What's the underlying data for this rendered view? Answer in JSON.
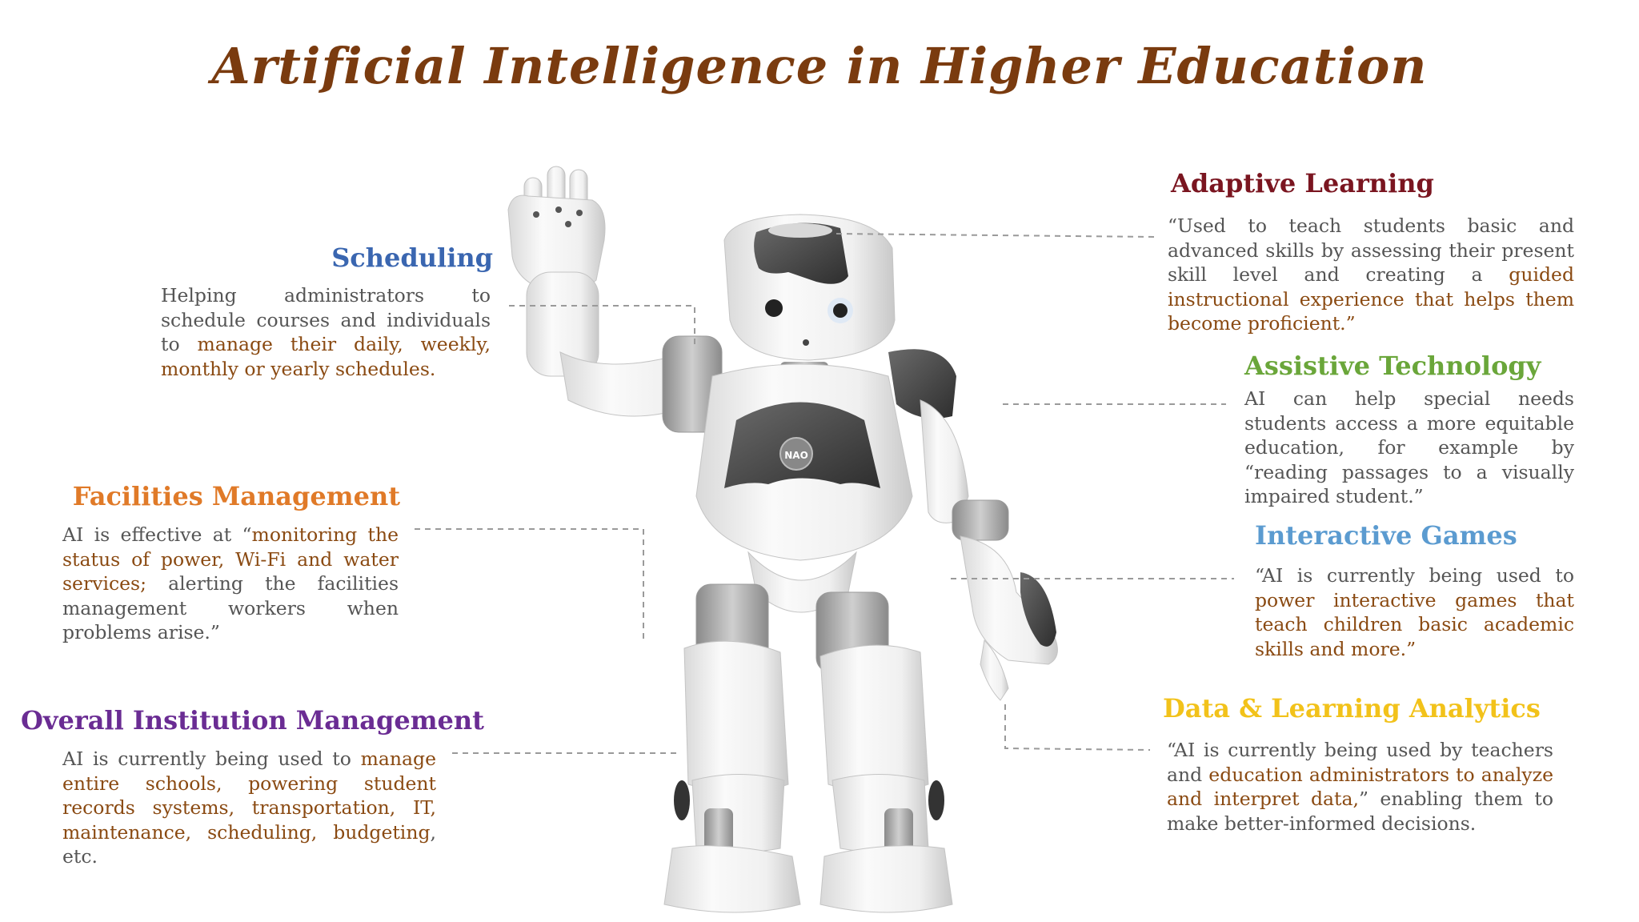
{
  "title": "Artificial Intelligence in Higher Education",
  "colors": {
    "title": "#7a3b0f",
    "scheduling": "#3a66b0",
    "facilities": "#e07a28",
    "overall": "#6a2c93",
    "adaptive": "#7a1520",
    "assistive": "#6aa63a",
    "games": "#5b9bd0",
    "analytics": "#f2c21a",
    "highlight": "#8a4a12",
    "body": "#555555"
  },
  "robot": {
    "badge": "NAO"
  },
  "sections": {
    "scheduling": {
      "heading": "Scheduling",
      "text_a": "Helping administrators to schedule courses and individuals to ",
      "text_b": "manage their daily, weekly, monthly or yearly schedules."
    },
    "facilities": {
      "heading": "Facilities Management",
      "text_a": "AI is effective at “",
      "text_b": "monitoring the status of power, Wi-Fi and water services;",
      "text_c": " alerting the facilities management workers when problems arise.”"
    },
    "overall": {
      "heading": "Overall Institution Management",
      "text_a": "AI is currently being used to ",
      "text_b": "manage entire schools, powering student records systems, transportation, IT, maintenance, scheduling, budgeting",
      "text_c": ", etc."
    },
    "adaptive": {
      "heading": "Adaptive Learning",
      "text_a": "“Used to teach students basic and advanced skills by assessing their present skill level and creating a ",
      "text_b": "guided instructional experience that helps them become proficient.”"
    },
    "assistive": {
      "heading": "Assistive Technology",
      "text_a": "AI can help special needs students access a more equitable education, for example by “reading passages to a visually impaired student.”"
    },
    "games": {
      "heading": "Interactive Games",
      "text_a": "“AI is currently being used to ",
      "text_b": "power interactive games that teach children basic academic skills and more.”"
    },
    "analytics": {
      "heading": "Data & Learning Analytics",
      "text_a": "“AI is currently being used by teachers and ",
      "text_b": "education administrators to analyze and interpret data,",
      "text_c": "” enabling them to make better-informed decisions."
    }
  }
}
